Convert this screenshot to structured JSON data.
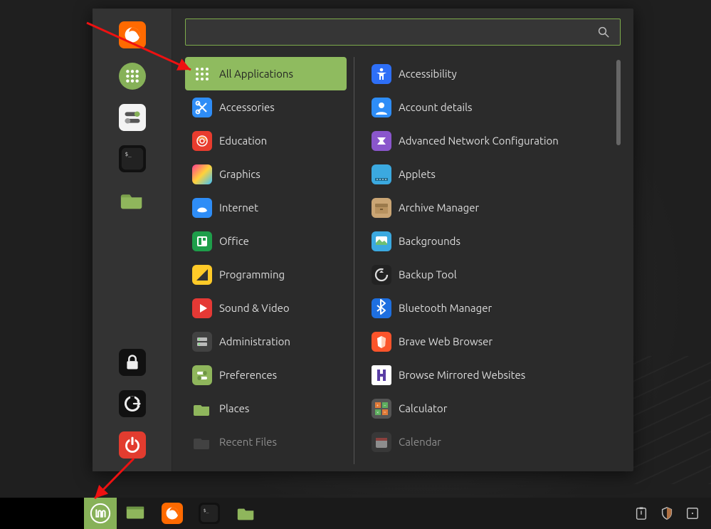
{
  "search": {
    "placeholder": ""
  },
  "categories": [
    {
      "id": "all",
      "label": "All Applications",
      "selected": true
    },
    {
      "id": "acc",
      "label": "Accessories"
    },
    {
      "id": "edu",
      "label": "Education"
    },
    {
      "id": "gfx",
      "label": "Graphics"
    },
    {
      "id": "net",
      "label": "Internet"
    },
    {
      "id": "off",
      "label": "Office"
    },
    {
      "id": "prog",
      "label": "Programming"
    },
    {
      "id": "sv",
      "label": "Sound & Video"
    },
    {
      "id": "admin",
      "label": "Administration"
    },
    {
      "id": "pref",
      "label": "Preferences"
    },
    {
      "id": "places",
      "label": "Places"
    },
    {
      "id": "recent",
      "label": "Recent Files",
      "dim": true
    }
  ],
  "apps": [
    {
      "id": "a11y",
      "label": "Accessibility"
    },
    {
      "id": "acct",
      "label": "Account details"
    },
    {
      "id": "anc",
      "label": "Advanced Network Configuration"
    },
    {
      "id": "applets",
      "label": "Applets"
    },
    {
      "id": "arch",
      "label": "Archive Manager"
    },
    {
      "id": "bg",
      "label": "Backgrounds"
    },
    {
      "id": "backup",
      "label": "Backup Tool"
    },
    {
      "id": "bt",
      "label": "Bluetooth Manager"
    },
    {
      "id": "brave",
      "label": "Brave Web Browser"
    },
    {
      "id": "bmw",
      "label": "Browse Mirrored Websites"
    },
    {
      "id": "calc",
      "label": "Calculator"
    },
    {
      "id": "cal",
      "label": "Calendar",
      "dim": true
    }
  ],
  "favorites": [
    {
      "id": "firefox",
      "name": "firefox-icon"
    },
    {
      "id": "apps-grid",
      "name": "apps-grid-icon"
    },
    {
      "id": "settings",
      "name": "settings-toggles-icon"
    },
    {
      "id": "terminal",
      "name": "terminal-icon"
    },
    {
      "id": "files",
      "name": "files-icon"
    }
  ],
  "session": [
    {
      "id": "lock",
      "name": "lock-icon"
    },
    {
      "id": "logout",
      "name": "logout-icon"
    },
    {
      "id": "power",
      "name": "power-icon"
    }
  ],
  "taskbar": [
    {
      "id": "menu",
      "name": "mint-menu-icon"
    },
    {
      "id": "desktop",
      "name": "show-desktop-icon"
    },
    {
      "id": "firefox",
      "name": "firefox-icon"
    },
    {
      "id": "terminal",
      "name": "terminal-icon"
    },
    {
      "id": "files",
      "name": "files-icon"
    }
  ],
  "tray": [
    {
      "id": "clipboard",
      "name": "clipboard-icon"
    },
    {
      "id": "shield",
      "name": "shield-icon"
    },
    {
      "id": "update",
      "name": "update-icon"
    }
  ]
}
